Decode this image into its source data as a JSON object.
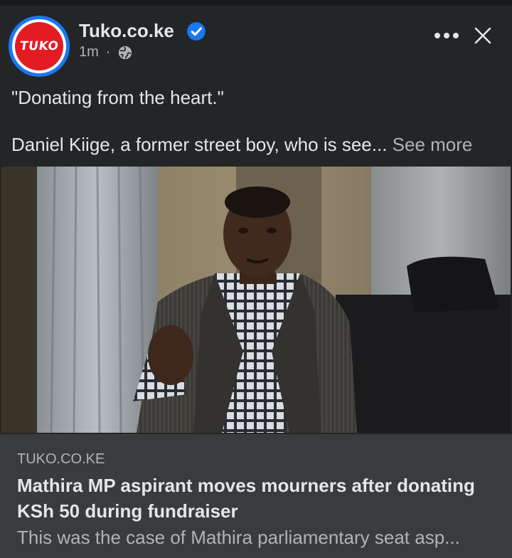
{
  "post": {
    "page_name": "Tuko.co.ke",
    "logo_text": "TUKO",
    "time": "1m",
    "separator": "·",
    "privacy_icon": "globe-icon",
    "verified_icon": "verified-badge-icon",
    "caption_line1": "\"Donating from the heart.\"",
    "caption_line2": "Daniel Kiige, a former street boy, who is see...",
    "see_more": "See more"
  },
  "link_preview": {
    "domain": "TUKO.CO.KE",
    "title": "Mathira MP aspirant moves mourners after donating KSh 50 during fundraiser",
    "description": "This was the case of Mathira parliamentary seat asp..."
  },
  "colors": {
    "background": "#242526",
    "link_box": "#3a3b3c",
    "verified_blue": "#1877f2",
    "brand_red": "#e31b23"
  }
}
